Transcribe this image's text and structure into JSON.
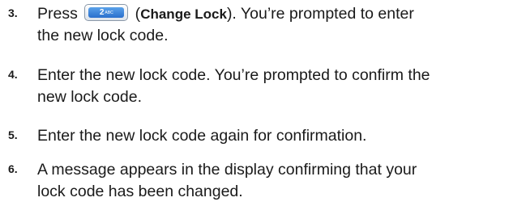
{
  "steps": [
    {
      "number": "3.",
      "line1_before": "Press ",
      "key": {
        "digit": "2",
        "letters": "ABC",
        "icon": "phone-key-2-abc-icon"
      },
      "line1_open_paren": " (",
      "bold": "Change Lock",
      "line1_after": "). You’re prompted to enter",
      "line2": "the new lock code."
    },
    {
      "number": "4.",
      "line1": "Enter the new lock code. You’re prompted to confirm the",
      "line2": "new lock code."
    },
    {
      "number": "5.",
      "line1": "Enter the new lock code again for confirmation."
    },
    {
      "number": "6.",
      "line1": "A message appears in the display confirming that your",
      "line2": "lock code has been changed."
    }
  ]
}
